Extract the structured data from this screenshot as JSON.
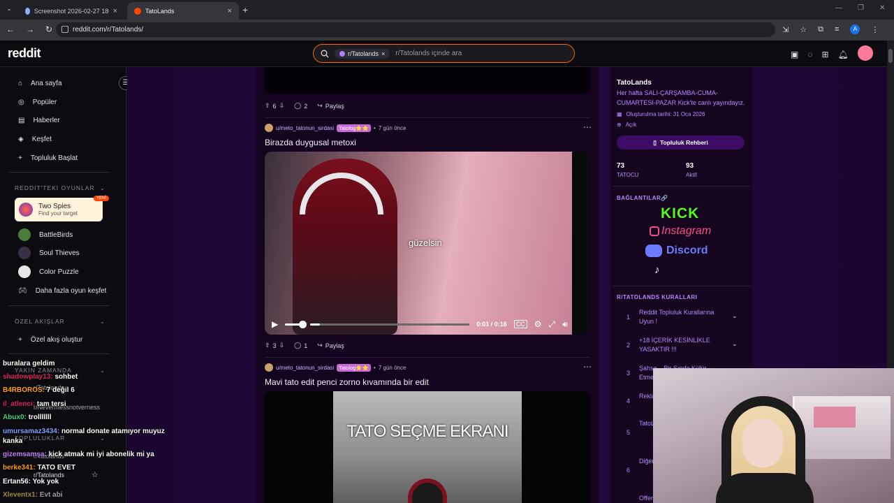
{
  "browser": {
    "tabs": [
      {
        "title": "Screenshot 2026-02-27 180511 - Ekran",
        "active": false
      },
      {
        "title": "TatoLands",
        "active": true
      }
    ],
    "url": "reddit.com/r/Tatolands/",
    "profile_initial": "A"
  },
  "header": {
    "logo": "reddit",
    "search_chip": "r/Tatolands",
    "search_placeholder": "r/Tatolands içinde ara"
  },
  "leftnav": {
    "items": [
      {
        "label": "Ana sayfa",
        "icon": "home-icon"
      },
      {
        "label": "Popüler",
        "icon": "popular-icon"
      },
      {
        "label": "Haberler",
        "icon": "news-icon"
      },
      {
        "label": "Keşfet",
        "icon": "explore-icon"
      },
      {
        "label": "Topluluk Başlat",
        "icon": "plus-icon"
      }
    ],
    "games_header": "REDDIT'TEKİ OYUNLAR",
    "featured_game": {
      "name": "Two Spies",
      "tagline": "Find your target",
      "badge": "YENİ"
    },
    "games": [
      {
        "label": "BattleBirds"
      },
      {
        "label": "Soul Thieves"
      },
      {
        "label": "Color Puzzle"
      },
      {
        "label": "Daha fazla oyun keşfet"
      }
    ],
    "feeds_header": "ÖZEL AKIŞLAR",
    "create_feed": "Özel akış oluştur",
    "recent_header": "YAKIN ZAMANDA",
    "recent": [
      "r/Tatolands",
      "r/Nevermessnotverness"
    ],
    "communities_header": "TOPLULUKLAR",
    "communities": [
      "r/Tatolands",
      "r/Tatolands"
    ]
  },
  "feed": {
    "top_post_actions": {
      "votes": "6",
      "comments": "2",
      "share": "Paylaş"
    },
    "posts": [
      {
        "author": "u/meto_tatonun_sirdasi",
        "flair": "Tatolog⭐⭐",
        "time": "7 gün önce",
        "title": "Birazda duygusal metoxi",
        "caption": "güzelsin",
        "video_time": "0:01 / 0:16",
        "progress": 0.06,
        "votes": "3",
        "comments": "1",
        "share": "Paylaş"
      },
      {
        "author": "u/meto_tatonun_sirdasi",
        "flair": "Tatolog⭐⭐",
        "time": "7 gün önce",
        "title": "Mavi tato edit penci zorno kıvamında bir edit",
        "caption": "TATO SEÇME EKRANI"
      }
    ]
  },
  "sidebar": {
    "name": "TatoLands",
    "description": "Her hafta SALI-ÇARŞAMBA-CUMA-CUMARTESİ-PAZAR Kick'te canlı yayındayız.",
    "created": "Oluşturulma tarihi: 31 Oca 2026",
    "visibility": "Açık",
    "guide_button": "Topluluk Rehberi",
    "stats": [
      {
        "value": "73",
        "label": "TATOCU"
      },
      {
        "value": "93",
        "label": "Aktif"
      }
    ],
    "links_header": "BAĞLANTILAR🔗",
    "links": [
      "KICK",
      "Instagram",
      "Discord"
    ],
    "rules_header": "R/TATOLANDS KURALLARI",
    "rules": [
      {
        "n": "1",
        "text": "Reddit Topluluk Kurallarına Uyun !"
      },
      {
        "n": "2",
        "text": "+18 İÇERİK KESİNLİKLE YASAKTIR !!!"
      },
      {
        "n": "3",
        "text": "Şahsa... Bir Sınıfa Küfür Etmeyin !"
      },
      {
        "n": "4",
        "text": "Rekla... Yasak..."
      },
      {
        "n": "5",
        "text": "TatoL... Payla... Payla..."
      },
      {
        "n": "6",
        "text": "Diğer... İçeri... Alma..."
      },
      {
        "n": "",
        "text": "Offer..."
      }
    ]
  },
  "chat": [
    {
      "user": "",
      "msg": "buralara geldim",
      "color": "#ffffff"
    },
    {
      "user": "shadowplay13:",
      "msg": "sohbet",
      "color": "#e0245e"
    },
    {
      "user": "B4RBOROS:",
      "msg": "7 değil 6",
      "color": "#ff9f1a"
    },
    {
      "user": "il_atlenci:",
      "msg": "tam tersi",
      "color": "#e0245e"
    },
    {
      "user": "Abux0:",
      "msg": "trolllllll",
      "color": "#3fd27f"
    },
    {
      "user": "umursamaz3434:",
      "msg": "normal donate atamıyor muyuz kanka",
      "color": "#7aa5ff"
    },
    {
      "user": "gizemsamşa:",
      "msg": "kick atmak mi iyi abonelik mi ya",
      "color": "#c67dff"
    },
    {
      "user": "berke341:",
      "msg": "TATO EVET",
      "color": "#ff9f1a"
    },
    {
      "user": "Ertan56:",
      "msg": "Yok yok",
      "color": "#ffffff"
    },
    {
      "user": "Xleventx1:",
      "msg": "Evt abi",
      "color": "#ffdd55"
    }
  ]
}
